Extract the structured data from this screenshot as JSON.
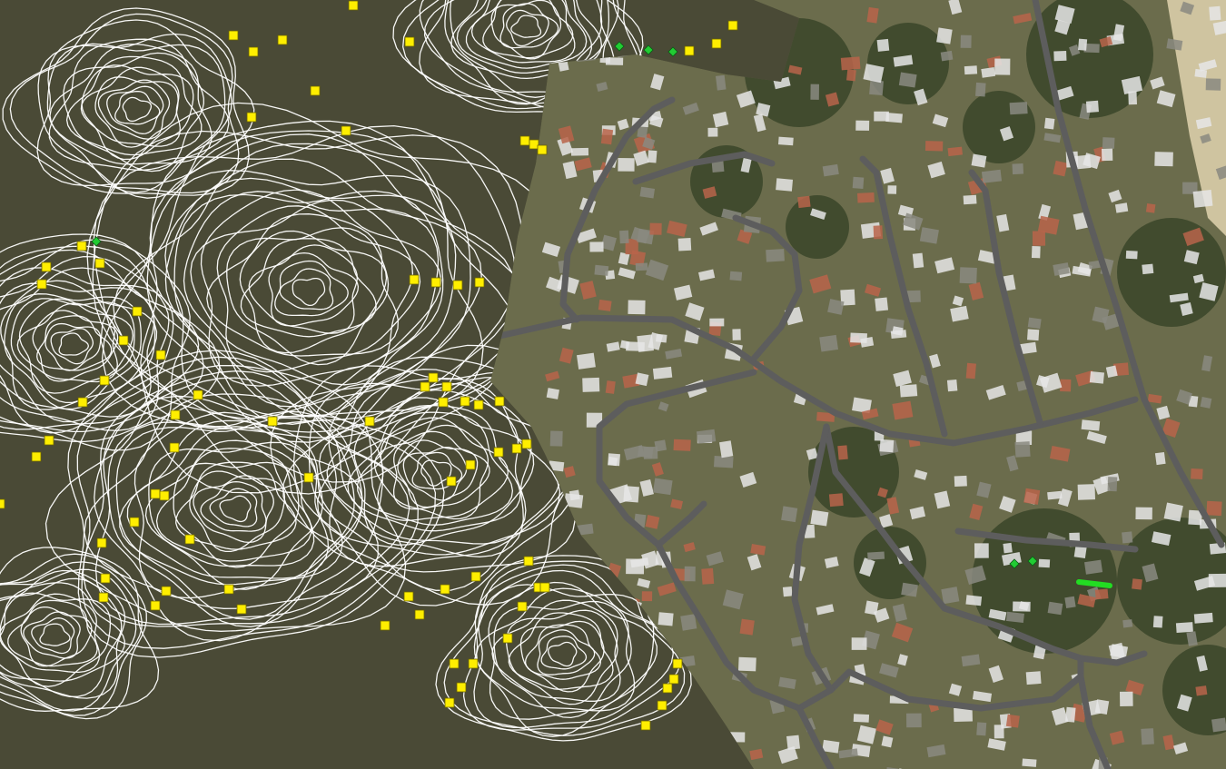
{
  "map": {
    "kind": "aerial-imagery-with-contour-overlay",
    "colors": {
      "terrain": "#4a4a36",
      "contour_line": "#ffffff",
      "suburb_ground": "#6b6c4c",
      "vegetation": "#2f3d22",
      "road": "#5d5d5d",
      "beach": "#cfc4a0",
      "roof_light": "#e6e6e6",
      "roof_red": "#b8644a",
      "marker_square": "#ffee00",
      "marker_diamond": "#22cc33",
      "marker_segment": "#22dd22"
    },
    "markers": {
      "square_count": 88,
      "diamond_count": 6,
      "segment_count": 1
    }
  }
}
